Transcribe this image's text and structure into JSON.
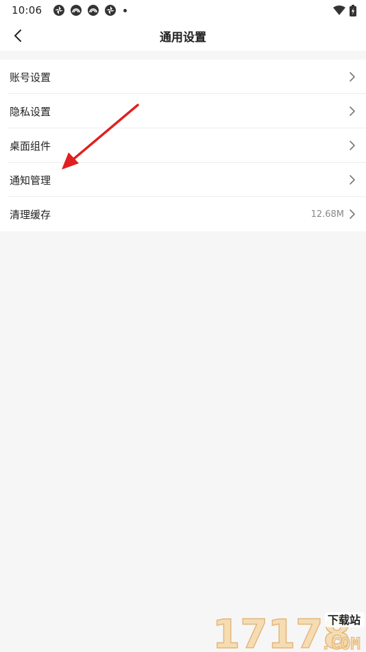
{
  "status_bar": {
    "time": "10:06",
    "notification_icons": [
      "aperture-icon",
      "rainbow-icon",
      "rainbow-icon",
      "aperture-icon"
    ],
    "system_icons": [
      "wifi-icon",
      "battery-charging-icon"
    ]
  },
  "header": {
    "title": "通用设置",
    "back_icon": "chevron-left-icon"
  },
  "settings": {
    "items": [
      {
        "label": "账号设置",
        "value": ""
      },
      {
        "label": "隐私设置",
        "value": ""
      },
      {
        "label": "桌面组件",
        "value": ""
      },
      {
        "label": "通知管理",
        "value": ""
      },
      {
        "label": "清理缓存",
        "value": "12.68M"
      }
    ]
  },
  "annotation": {
    "color": "#e02020"
  },
  "watermark": {
    "site_number": "17178",
    "site_domain": ".COM",
    "tagline": "下载站"
  },
  "colors": {
    "background": "#f6f6f6",
    "surface": "#ffffff",
    "text": "#222222",
    "secondary_text": "#888888"
  }
}
